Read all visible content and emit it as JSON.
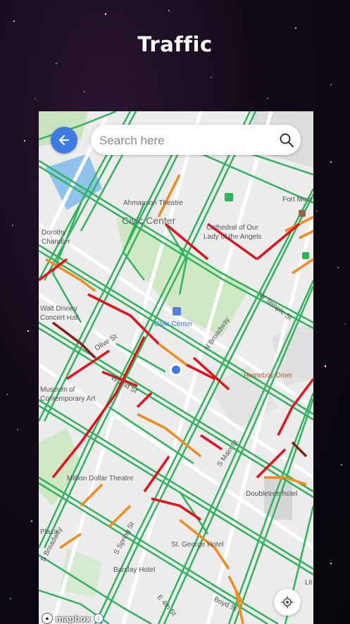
{
  "header": {
    "title": "Traffic"
  },
  "search": {
    "placeholder": "Search here"
  },
  "map": {
    "labels": {
      "civic_center": "Civic Center",
      "ahmanson": "Ahmanson Theatre",
      "cathedral1": "Cathedral of Our",
      "cathedral2": "Lady of the Angels",
      "fort": "Fort Moore",
      "dorothy1": "Dorothy",
      "dorothy2": "Chandler",
      "walt1": "Walt Disney",
      "walt2": "Concert Hall",
      "civic_station": "Civic Center",
      "homeboy": "Homeboy Diner",
      "museum1": "Museum of",
      "museum2": "Contemporary Art",
      "million": "Million Dollar Theatre",
      "doubletree": "Doubletree hotel",
      "st_george": "St. George Hotel",
      "barclay": "Barclay Hotel",
      "plaza": "Plaza",
      "lit": "Lit",
      "st_olive": "Olive St",
      "st_w2nd": "W 2nd St",
      "st_nbroadway": "N Broadway",
      "st_wtemple": "W Temple St",
      "st_smain": "S Main St",
      "st_sspring": "S Spring St",
      "st_broadway": "S Broadway",
      "st_e4th": "E 4th St",
      "st_boyd": "Boyd St"
    },
    "attribution": "mapbox",
    "colors": {
      "free_flow": "#2fb35c",
      "moderate": "#f08c1e",
      "heavy": "#e3121b",
      "severe": "#8b1d1d",
      "location_dot": "#3d7be3"
    }
  }
}
